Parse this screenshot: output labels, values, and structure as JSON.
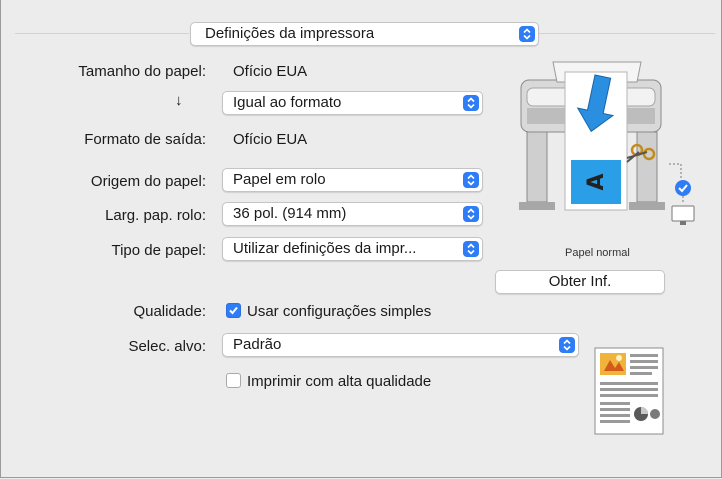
{
  "top_popup": {
    "value": "Definições da impressora"
  },
  "rows": {
    "paper_size": {
      "label": "Tamanho do papel:",
      "value": "Ofício EUA"
    },
    "scale_arrow": {
      "icon": "down-arrow-icon",
      "glyph": "↓"
    },
    "scale": {
      "value": "Igual ao formato"
    },
    "output_format": {
      "label": "Formato de saída:",
      "value": "Ofício EUA"
    },
    "paper_source": {
      "label": "Origem do papel:",
      "value": "Papel em rolo"
    },
    "roll_width": {
      "label": "Larg. pap. rolo:",
      "value": "36 pol. (914 mm)"
    },
    "paper_type": {
      "label": "Tipo de papel:",
      "value": "Utilizar definições da impr..."
    }
  },
  "printer_preview": {
    "icon": "printer-icon",
    "caption": "Papel normal",
    "button_label": "Obter Inf.",
    "page_letter": "A"
  },
  "quality": {
    "label": "Qualidade:",
    "checkbox_label": "Usar configurações simples",
    "checked": true
  },
  "target": {
    "label": "Selec. alvo:",
    "value": "Padrão",
    "icon": "document-preview-icon"
  },
  "high_quality": {
    "checkbox_label": "Imprimir com alta qualidade",
    "checked": false
  },
  "colors": {
    "accent": "#2f7df6",
    "background": "#ececec",
    "printer_blue": "#2a8fe0"
  }
}
